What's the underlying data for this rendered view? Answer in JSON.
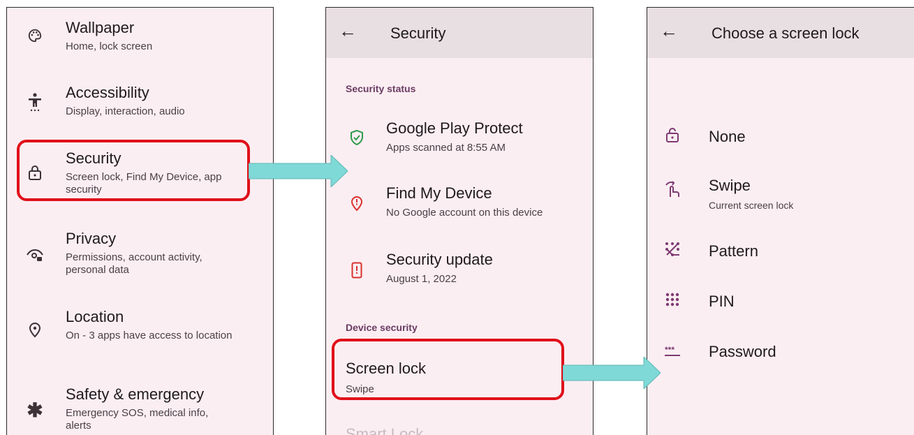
{
  "colors": {
    "highlight": "#e0101a",
    "arrow": "#7fd9d6",
    "panel_bg": "#fbeef2",
    "appbar_bg": "#e8dfe2",
    "section": "#6a3b63",
    "shield": "#2e9a4b",
    "alert": "#d9332e"
  },
  "settings": {
    "items": [
      {
        "title": "Wallpaper",
        "subtitle": "Home, lock screen",
        "icon": "palette-icon"
      },
      {
        "title": "Accessibility",
        "subtitle": "Display, interaction, audio",
        "icon": "accessibility-icon"
      },
      {
        "title": "Security",
        "subtitle": "Screen lock, Find My Device, app security",
        "icon": "lock-icon"
      },
      {
        "title": "Privacy",
        "subtitle": "Permissions, account activity, personal data",
        "icon": "privacy-eye-icon"
      },
      {
        "title": "Location",
        "subtitle": "On - 3 apps have access to location",
        "icon": "location-pin-icon"
      },
      {
        "title": "Safety & emergency",
        "subtitle": "Emergency SOS, medical info, alerts",
        "icon": "asterisk-icon"
      }
    ]
  },
  "security": {
    "title": "Security",
    "status_header": "Security status",
    "items": [
      {
        "title": "Google Play Protect",
        "subtitle": "Apps scanned at 8:55 AM",
        "icon": "shield-check-icon"
      },
      {
        "title": "Find My Device",
        "subtitle": "No Google account on this device",
        "icon": "location-alert-icon"
      },
      {
        "title": "Security update",
        "subtitle": "August 1, 2022",
        "icon": "phone-alert-icon"
      }
    ],
    "device_header": "Device security",
    "screen_lock": {
      "title": "Screen lock",
      "subtitle": "Swipe"
    },
    "smart_lock": "Smart Lock"
  },
  "screen_lock_chooser": {
    "title": "Choose a screen lock",
    "options": [
      {
        "label": "None",
        "icon": "unlock-icon"
      },
      {
        "label": "Swipe",
        "subtitle": "Current screen lock",
        "icon": "swipe-icon"
      },
      {
        "label": "Pattern",
        "icon": "pattern-icon"
      },
      {
        "label": "PIN",
        "icon": "pin-grid-icon"
      },
      {
        "label": "Password",
        "icon": "password-icon"
      }
    ]
  }
}
